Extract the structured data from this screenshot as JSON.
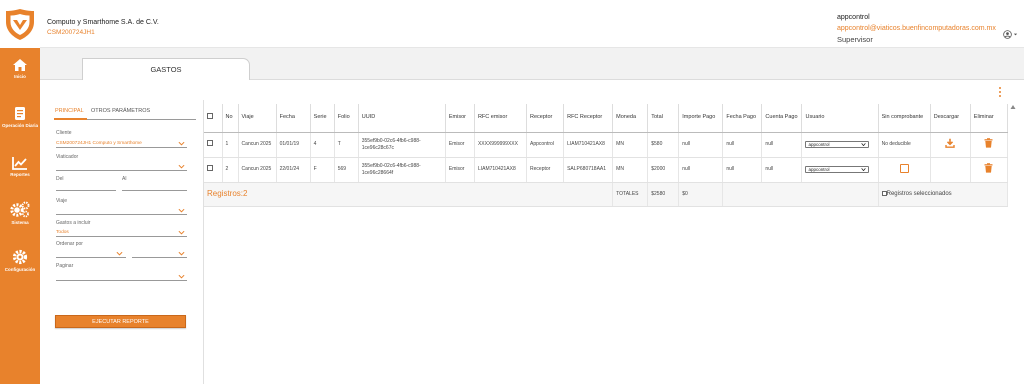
{
  "company": {
    "name": "Computo y Smarthome S.A. de C.V.",
    "rfc": "CSM200724JH1"
  },
  "user": {
    "name": "appcontrol",
    "email": "appcontrol@viaticos.buenfincomputadoras.com.mx",
    "role": "Supervisor"
  },
  "sidebar": {
    "items": [
      {
        "label": "Inicio",
        "icon": "home-icon"
      },
      {
        "label": "Operación Diaria",
        "icon": "document-icon"
      },
      {
        "label": "Reportes",
        "icon": "chart-icon"
      },
      {
        "label": "Sistema",
        "icon": "gears-icon"
      },
      {
        "label": "Configuración",
        "icon": "gear-icon"
      }
    ]
  },
  "tab": {
    "label": "GASTOS"
  },
  "filters": {
    "tabs": [
      "PRINCIPAL",
      "OTROS PARÁMETROS"
    ],
    "cliente_label": "Cliente",
    "cliente_value": "CSM200724JH1 Computo y Smarthome",
    "viaticador_label": "Viaticador",
    "del_label": "Del",
    "al_label": "Al",
    "viaje_label": "Viaje",
    "gastos_label": "Gastos a incluir",
    "gastos_value": "Todos",
    "ordenar_label": "Ordenar por",
    "paginar_label": "Paginar",
    "execute_label": "EJECUTAR REPORTE"
  },
  "table": {
    "headers": [
      "No",
      "Viaje",
      "Fecha",
      "Serie",
      "Folio",
      "UUID",
      "Emisor",
      "RFC emisor",
      "Receptor",
      "RFC Receptor",
      "Moneda",
      "Total",
      "Importe Pago",
      "Fecha Pago",
      "Cuenta Pago",
      "Usuario",
      "Sin comprobante",
      "Descargar",
      "Eliminar"
    ],
    "rows": [
      {
        "no": "1",
        "viaje": "Cancun 2025",
        "fecha": "01/01/19",
        "serie": "4",
        "folio": "T",
        "uuid": "355ef9b0-02c6-4fb6-c988-1ce96c28c67c",
        "emisor": "Emisor",
        "rfc_emisor": "XXXX999999XXX",
        "receptor": "Appcontrol",
        "rfc_receptor": "LIAM710421AX8",
        "moneda": "MN",
        "total": "$580",
        "importe_pago": "null",
        "fecha_pago": "null",
        "cuenta_pago": "null",
        "usuario": "appcontrol",
        "sin_comprobante": "No deducible"
      },
      {
        "no": "2",
        "viaje": "Cancun 2025",
        "fecha": "22/01/24",
        "serie": "F",
        "folio": "569",
        "uuid": "355ef9b0-02c6-4fb6-c988-1ce96c28664f",
        "emisor": "Emisor",
        "rfc_emisor": "LIAM710421AX8",
        "receptor": "Receptor",
        "rfc_receptor": "SALP680718AA1",
        "moneda": "MN",
        "total": "$2000",
        "importe_pago": "null",
        "fecha_pago": "null",
        "cuenta_pago": "null",
        "usuario": "appcontrol",
        "sin_comprobante": ""
      }
    ],
    "footer": {
      "registros": "Registros:2",
      "totales_label": "TOTALES",
      "total": "$2580",
      "importe_pago": "$0",
      "seleccionados": "Registros seleccionados"
    }
  },
  "colors": {
    "accent": "#e8822c",
    "sidebar": "#e8822c"
  }
}
